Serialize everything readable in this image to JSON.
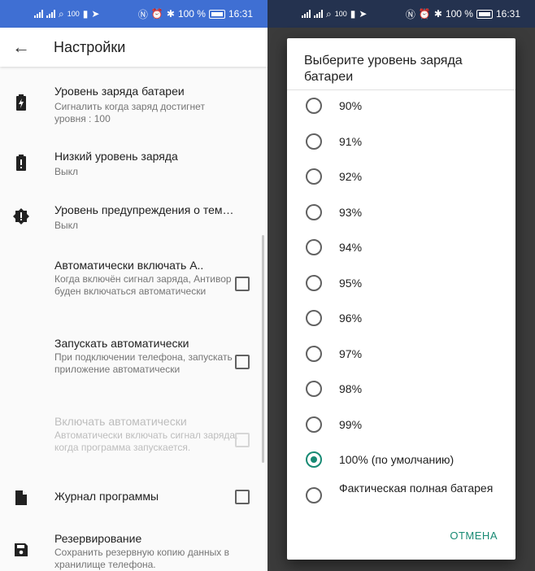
{
  "status_bar": {
    "network": "100",
    "battery": "100 %",
    "time": "16:31"
  },
  "settings": {
    "title": "Настройки",
    "items": [
      {
        "icon": "battery-charging-icon",
        "title": "Уровень заряда батареи",
        "summary": "Сигналить когда заряд достигнет уровня : 100"
      },
      {
        "icon": "battery-alert-icon",
        "title": "Низкий уровень заряда",
        "summary": "Выкл"
      },
      {
        "icon": "temperature-alert-icon",
        "title": "Уровень предупреждения о темпе..",
        "summary": "Выкл"
      },
      {
        "title": "Автоматически включать А..",
        "summary": "Когда включён сигнал заряда, Антивор буден включаться автоматически",
        "checked": false
      },
      {
        "title": "Запускать автоматически",
        "summary": "При подключении телефона, запускать приложение автоматически",
        "checked": false
      },
      {
        "title": "Включать автоматически",
        "summary": "Автоматически включать сигнал заряда, когда программа запускается.",
        "checked": false,
        "disabled": true
      },
      {
        "icon": "file-icon",
        "title": "Журнал программы",
        "checked": false
      },
      {
        "icon": "save-icon",
        "title": "Резервирование",
        "summary": "Сохранить резервную копию данных в хранилище телефона."
      }
    ]
  },
  "dialog": {
    "title": "Выберите уровень заряда батареи",
    "options": [
      "90%",
      "91%",
      "92%",
      "93%",
      "94%",
      "95%",
      "96%",
      "97%",
      "98%",
      "99%",
      "100% (по умолчанию)",
      "Фактическая полная батарея"
    ],
    "selected_index": 10,
    "cancel_label": "ОТМЕНА"
  },
  "colors": {
    "status_left": "#3f6fd3",
    "status_right": "#24324f",
    "accent": "#188a74"
  }
}
